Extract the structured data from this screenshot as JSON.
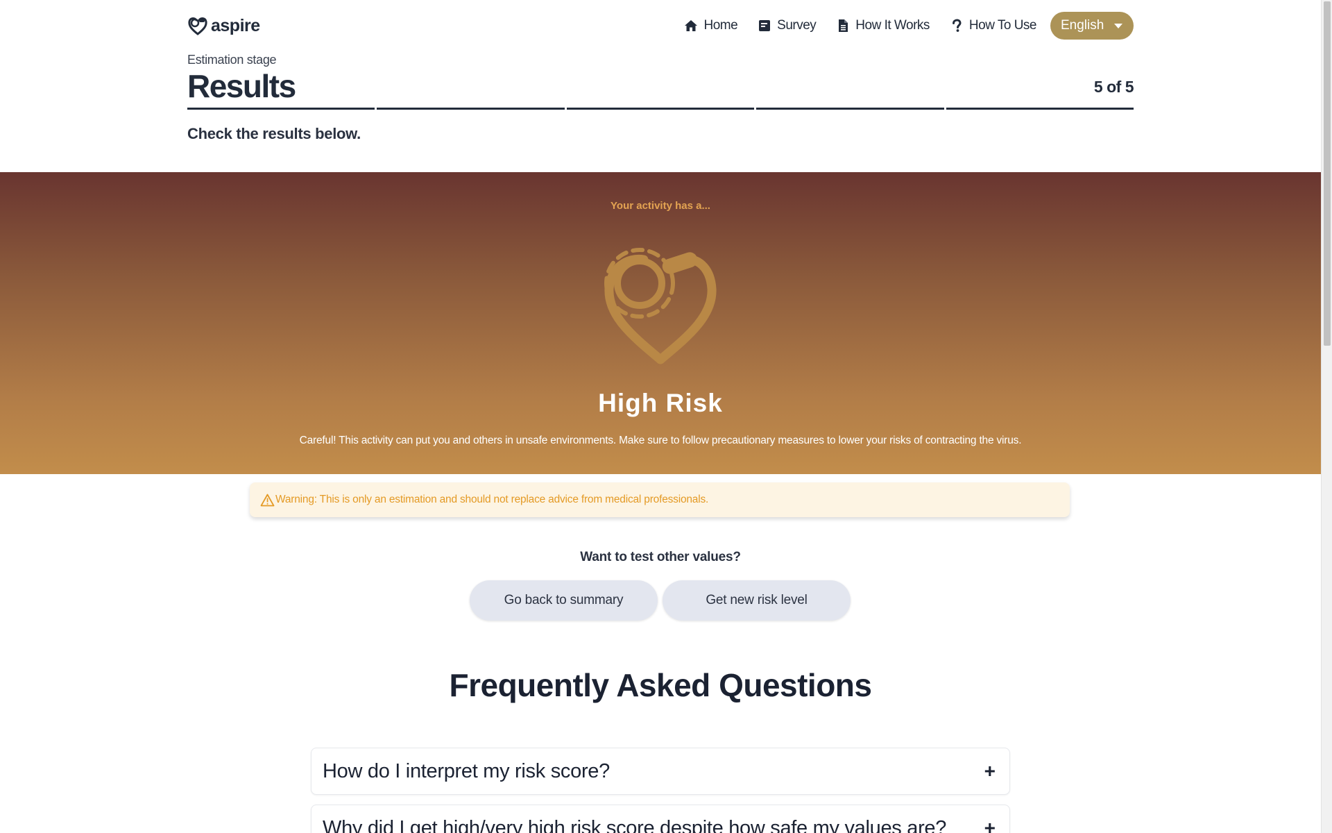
{
  "brand": {
    "name": "aspire",
    "logo_icon": "heart-logo-icon"
  },
  "nav": {
    "items": [
      {
        "label": "Home",
        "icon": "home-icon"
      },
      {
        "label": "Survey",
        "icon": "survey-icon"
      },
      {
        "label": "How It Works",
        "icon": "document-icon"
      },
      {
        "label": "How To Use",
        "icon": "question-icon"
      }
    ],
    "language": {
      "selected": "English",
      "icon": "caret-down-icon"
    }
  },
  "stage": {
    "label": "Estimation stage",
    "title": "Results",
    "count": "5 of 5",
    "progress_segments": 5,
    "progress_completed": 5,
    "instructions": "Check the results below."
  },
  "result": {
    "kicker": "Your activity has a...",
    "level": "High Risk",
    "description": "Careful! This activity can put you and others in unsafe environments. Make sure to follow precautionary measures to lower your risks of contracting the virus.",
    "icon": "heart-virus-icon",
    "colors": {
      "gradient_top": "#693530",
      "gradient_bottom": "#c28d4b",
      "icon": "#b98846",
      "kicker": "#e3a352"
    }
  },
  "warning": {
    "icon": "warning-triangle-icon",
    "text": "Warning: This is only an estimation and should not replace advice from medical professionals."
  },
  "retest": {
    "question": "Want to test other values?",
    "buttons": [
      {
        "label": "Go back to summary"
      },
      {
        "label": "Get new risk level"
      }
    ]
  },
  "faq": {
    "title": "Frequently Asked Questions",
    "items": [
      {
        "question": "How do I interpret my risk score?",
        "toggle": "+"
      },
      {
        "question": "Why did I get high/very high risk score despite how safe my values are?",
        "toggle": "+"
      }
    ]
  },
  "colors": {
    "accent": "#ac9357",
    "text": "#222b3a",
    "warning_bg": "#fdf4e3",
    "warning_text": "#e49a25",
    "button_bg": "#e3e6ef"
  }
}
